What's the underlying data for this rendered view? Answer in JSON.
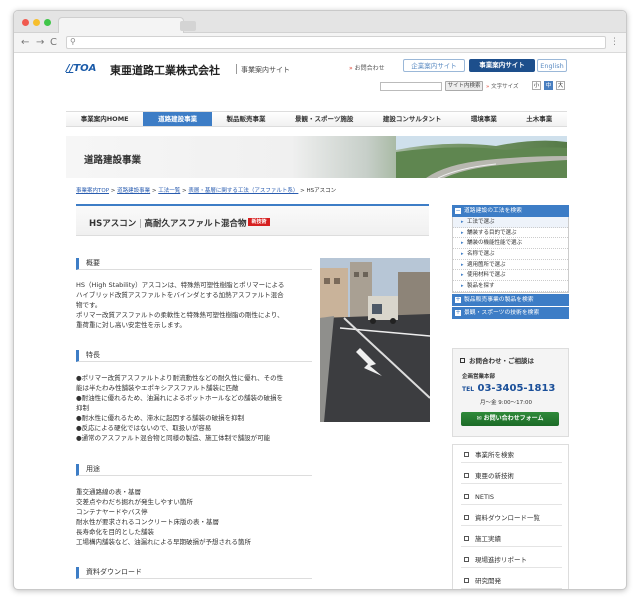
{
  "header": {
    "logo_mark": "TOA",
    "company_name": "東亜道路工業株式会社",
    "site_subtitle": "事業案内サイト",
    "contact_link": "お問合わせ",
    "site_buttons": [
      "企業案内サイト",
      "事業案内サイト",
      "English"
    ],
    "search_button": "サイト内検索",
    "font_size_label": "文字サイズ",
    "font_sizes": [
      "小",
      "中",
      "大"
    ]
  },
  "nav": {
    "items": [
      "事業案内HOME",
      "道路建設事業",
      "製品販売事業",
      "景観・スポーツ施設",
      "建設コンサルタント",
      "環境事業",
      "土木事業"
    ],
    "active_index": 1
  },
  "banner": {
    "title": "道路建設事業"
  },
  "breadcrumb": {
    "links": [
      "事業案内TOP",
      "道路建設事業",
      "工法一覧",
      "表層・基層に関する工法（アスファルト系）"
    ],
    "sep": ">",
    "current": "HSアスコン"
  },
  "product": {
    "name": "HSアスコン",
    "separator": "|",
    "subtitle": "高耐久アスファルト混合物",
    "badge": "新技術"
  },
  "sections": {
    "overview": {
      "heading": "概要",
      "lines": [
        "HS（High Stability）アスコンは、特殊熱可塑性樹脂とポリマーによる",
        "ハイブリッド改質アスファルトをバインダとする加熱アスファルト混合",
        "物です。",
        "ポリマー改質アスファルトの柔軟性と特殊熱可塑性樹脂の剛性により、",
        "重荷重に対し高い安定性を示します。"
      ]
    },
    "features": {
      "heading": "特長",
      "lines": [
        "●ポリマー改質アスファルトより耐流動性などの耐久性に優れ、その性",
        "能は半たわみ性舗装やエポキシアスファルト舗装に匹敵",
        "●耐油性に優れるため、油漏れによるポットホールなどの舗装の破損を",
        "抑制",
        "●耐水性に優れるため、滞水に起因する舗装の破損を抑制",
        "●反応による硬化ではないので、取扱いが容易",
        "●通常のアスファルト混合物と同様の製造、施工体制で舗設が可能"
      ]
    },
    "uses": {
      "heading": "用途",
      "lines": [
        "重交通路線の表・基層",
        "交差点やわだち掘れが発生しやすい箇所",
        "コンテナヤードやバス停",
        "耐水性が要求されるコンクリート床版の表・基層",
        "長寿命化を目的とした舗装",
        "工場構内舗装など、油漏れによる早期破損が予想される箇所"
      ]
    },
    "downloads": {
      "heading": "資料ダウンロード"
    }
  },
  "sidebar": {
    "group1": {
      "title": "道路建設の工法を検索",
      "items": [
        "工法で選ぶ",
        "舗装する目的で選ぶ",
        "舗装の機能性能で選ぶ",
        "名称で選ぶ",
        "適用箇所で選ぶ",
        "使用材料で選ぶ",
        "製品を探す"
      ]
    },
    "group2_title": "製品販売事業の製品を検索",
    "group3_title": "景観・スポーツの技術を検索",
    "contact": {
      "title": "お問合わせ・ご相談は",
      "office": "企画営業本部",
      "tel_label": "TEL",
      "tel": "03-3405-1813",
      "hours": "月〜金 9:00〜17:00",
      "button": "お問い合わせフォーム"
    },
    "links": [
      "事業所を検索",
      "東亜の新技術",
      "NETIS",
      "資料ダウンロード一覧",
      "施工実績",
      "現場進捗リポート",
      "研究開発"
    ]
  },
  "colors": {
    "brand_blue": "#3d7dc6",
    "navy": "#1d4f8c",
    "badge_red": "#d62020",
    "form_green": "#2f8a3a"
  }
}
